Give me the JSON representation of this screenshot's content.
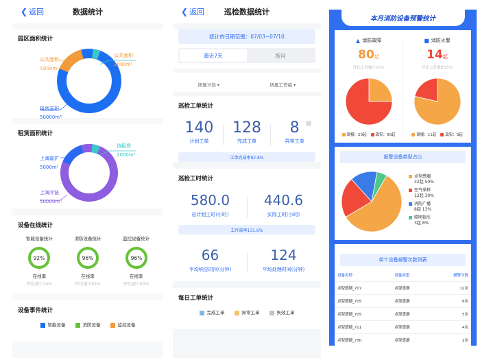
{
  "panel1": {
    "nav": {
      "back": "返回",
      "title": "数据统计"
    },
    "area": {
      "title": "园区面积统计",
      "public_label": "公共面积",
      "public_value": "5000m²",
      "common_label": "公共面积",
      "common_value": "2000m²",
      "rent_label": "租赁面积",
      "rent_value": "50000m³",
      "colors": {
        "rent": "#1d6ff2",
        "public": "#f29b3a",
        "common": "#3ec7c9"
      }
    },
    "lease": {
      "title": "租赁面积统计",
      "shanghai_expand_label": "上海嘉扩",
      "shanghai_expand_value": "5000m²",
      "pending_label": "待租赁",
      "pending_value": "2000m²",
      "shanghai_cold_label": "上海冷链",
      "shanghai_cold_value": "50000m³",
      "colors": {
        "cold": "#8e5de0",
        "expand": "#2b6af0",
        "pending": "#3ec7c9"
      }
    },
    "online": {
      "title": "设备在线统计",
      "gauges": [
        {
          "name": "智能设备统计",
          "value": "92%",
          "rate": "在线率",
          "cmp": "环比减少20%"
        },
        {
          "name": "消防设备统计",
          "value": "96%",
          "rate": "在线率",
          "cmp": "环比减少63%"
        },
        {
          "name": "监控设备统计",
          "value": "96%",
          "rate": "在线率",
          "cmp": "环比减少63%"
        }
      ]
    },
    "events": {
      "title": "设备事件统计",
      "legend": [
        {
          "label": "智能设备",
          "color": "#1d6ff2"
        },
        {
          "label": "消防设备",
          "color": "#67c23a"
        },
        {
          "label": "监控设备",
          "color": "#f29b3a"
        }
      ]
    }
  },
  "panel2": {
    "nav": {
      "back": "返回",
      "title": "巡检数据统计"
    },
    "date_range": "统计的日期范围：07/03~07/10",
    "tabs": [
      "最近7天",
      "按月"
    ],
    "filters": [
      "所属计划",
      "所属工作组"
    ],
    "work_orders": {
      "title": "巡检工单统计",
      "stats": [
        {
          "num": "140",
          "cap": "计划工单"
        },
        {
          "num": "128",
          "cap": "完成工单"
        },
        {
          "num": "8",
          "cap": "异常工单"
        }
      ],
      "rate": "工单完成率92.8%"
    },
    "hours": {
      "title": "巡检工时统计",
      "stats": [
        {
          "num": "580.0",
          "cap": "总计划工时(小时)"
        },
        {
          "num": "440.6",
          "cap": "实际工时(小时)"
        }
      ],
      "rate": "工作效率131.6%",
      "stats2": [
        {
          "num": "66",
          "cap": "平均响应时间(分钟)"
        },
        {
          "num": "124",
          "cap": "平均处理时间(分钟)"
        }
      ]
    },
    "daily": {
      "title": "每日工单统计",
      "legend": [
        {
          "label": "完成工单",
          "color": "#7ab8e8"
        },
        {
          "label": "异常工单",
          "color": "#f5c26b"
        },
        {
          "label": "失效工单",
          "color": "#c0c4cc"
        }
      ]
    }
  },
  "panel3": {
    "banner": "本月消防设备预警统计",
    "faults": {
      "title": "消防故障",
      "num": "80",
      "unit": "起",
      "cmp": "环比上月减少20%",
      "chart_data": {
        "type": "pie",
        "categories": [
          "误报",
          "真实"
        ],
        "values": [
          20,
          60
        ]
      },
      "legend": [
        "误报：20起",
        "真实：60起"
      ]
    },
    "fires": {
      "title": "消防火警",
      "num": "14",
      "unit": "起",
      "cmp": "环比上月增加15%",
      "chart_data": {
        "type": "pie",
        "categories": [
          "误报",
          "真实"
        ],
        "values": [
          11,
          3
        ]
      },
      "legend": [
        "误报：11起",
        "真实：3起"
      ]
    },
    "colors": {
      "false_alarm": "#f5a646",
      "real": "#f0493a"
    },
    "type_share": {
      "title": "报警设备类型占比",
      "chart_data": {
        "type": "pie",
        "categories": [
          "点型感烟",
          "空气采样",
          "消防广播",
          "照明指引"
        ],
        "values": [
          32,
          12,
          8,
          3
        ],
        "colors": [
          "#f5a646",
          "#f0493a",
          "#3b7be8",
          "#4fc98a"
        ]
      },
      "legend": [
        {
          "name": "点型感烟",
          "detail": "32起 50%"
        },
        {
          "name": "空气采样",
          "detail": "12起 30%"
        },
        {
          "name": "消防广播",
          "detail": "8起 13%"
        },
        {
          "name": "照明指引",
          "detail": "3起 8%"
        }
      ]
    },
    "ranking": {
      "title": "单个设备报警次数列表",
      "headers": [
        "设备名称",
        "设备类型",
        "报警次数"
      ],
      "rows": [
        [
          "点型感烟_707",
          "点型感烟",
          "12次"
        ],
        [
          "点型感烟_705",
          "点型感烟",
          "6次"
        ],
        [
          "点型感烟_705",
          "点型感烟",
          "5次"
        ],
        [
          "点型感烟_711",
          "点型感烟",
          "4次"
        ],
        [
          "点型感烟_730",
          "点型感烟",
          "2次"
        ]
      ]
    }
  }
}
